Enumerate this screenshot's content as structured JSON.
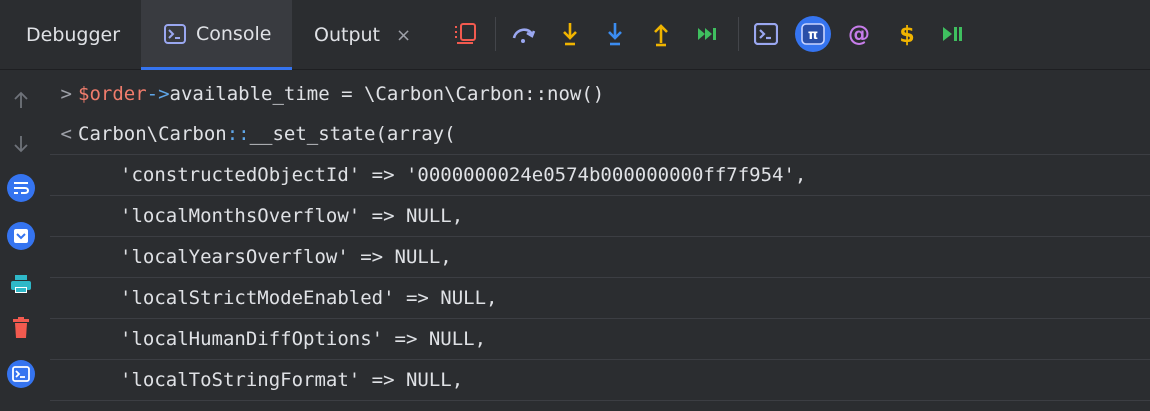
{
  "tabs": {
    "debugger": "Debugger",
    "console": "Console",
    "output": "Output",
    "close_glyph": "×"
  },
  "toolbar_icons": [
    "layout-icon",
    "step-over-icon",
    "step-into-icon",
    "force-step-into-icon",
    "step-out-icon",
    "run-to-cursor-icon",
    "evaluate-console-icon",
    "tinker-icon",
    "at-icon",
    "dollar-icon",
    "resume-icon"
  ],
  "console": {
    "input": {
      "prompt": ">",
      "var": "$order",
      "arrow": "->",
      "rest": "available_time = \\Carbon\\Carbon::now()"
    },
    "output_header": {
      "prompt": "<",
      "text_a": "Carbon\\Carbon",
      "text_b": "::",
      "text_c": "__set_state(array("
    },
    "lines": [
      "'constructedObjectId' => '0000000024e0574b000000000ff7f954',",
      "'localMonthsOverflow' => NULL,",
      "'localYearsOverflow' => NULL,",
      "'localStrictModeEnabled' => NULL,",
      "'localHumanDiffOptions' => NULL,",
      "'localToStringFormat' => NULL,"
    ]
  },
  "colors": {
    "background": "#2b2d30",
    "accent_blue": "#3574f0",
    "variable": "#f07c6c",
    "operator": "#5fa6e8",
    "step_orange": "#f0b400",
    "step_blue": "#3b8cf0",
    "resume_green": "#3fbf5f",
    "layout_red": "#f25a4f"
  }
}
